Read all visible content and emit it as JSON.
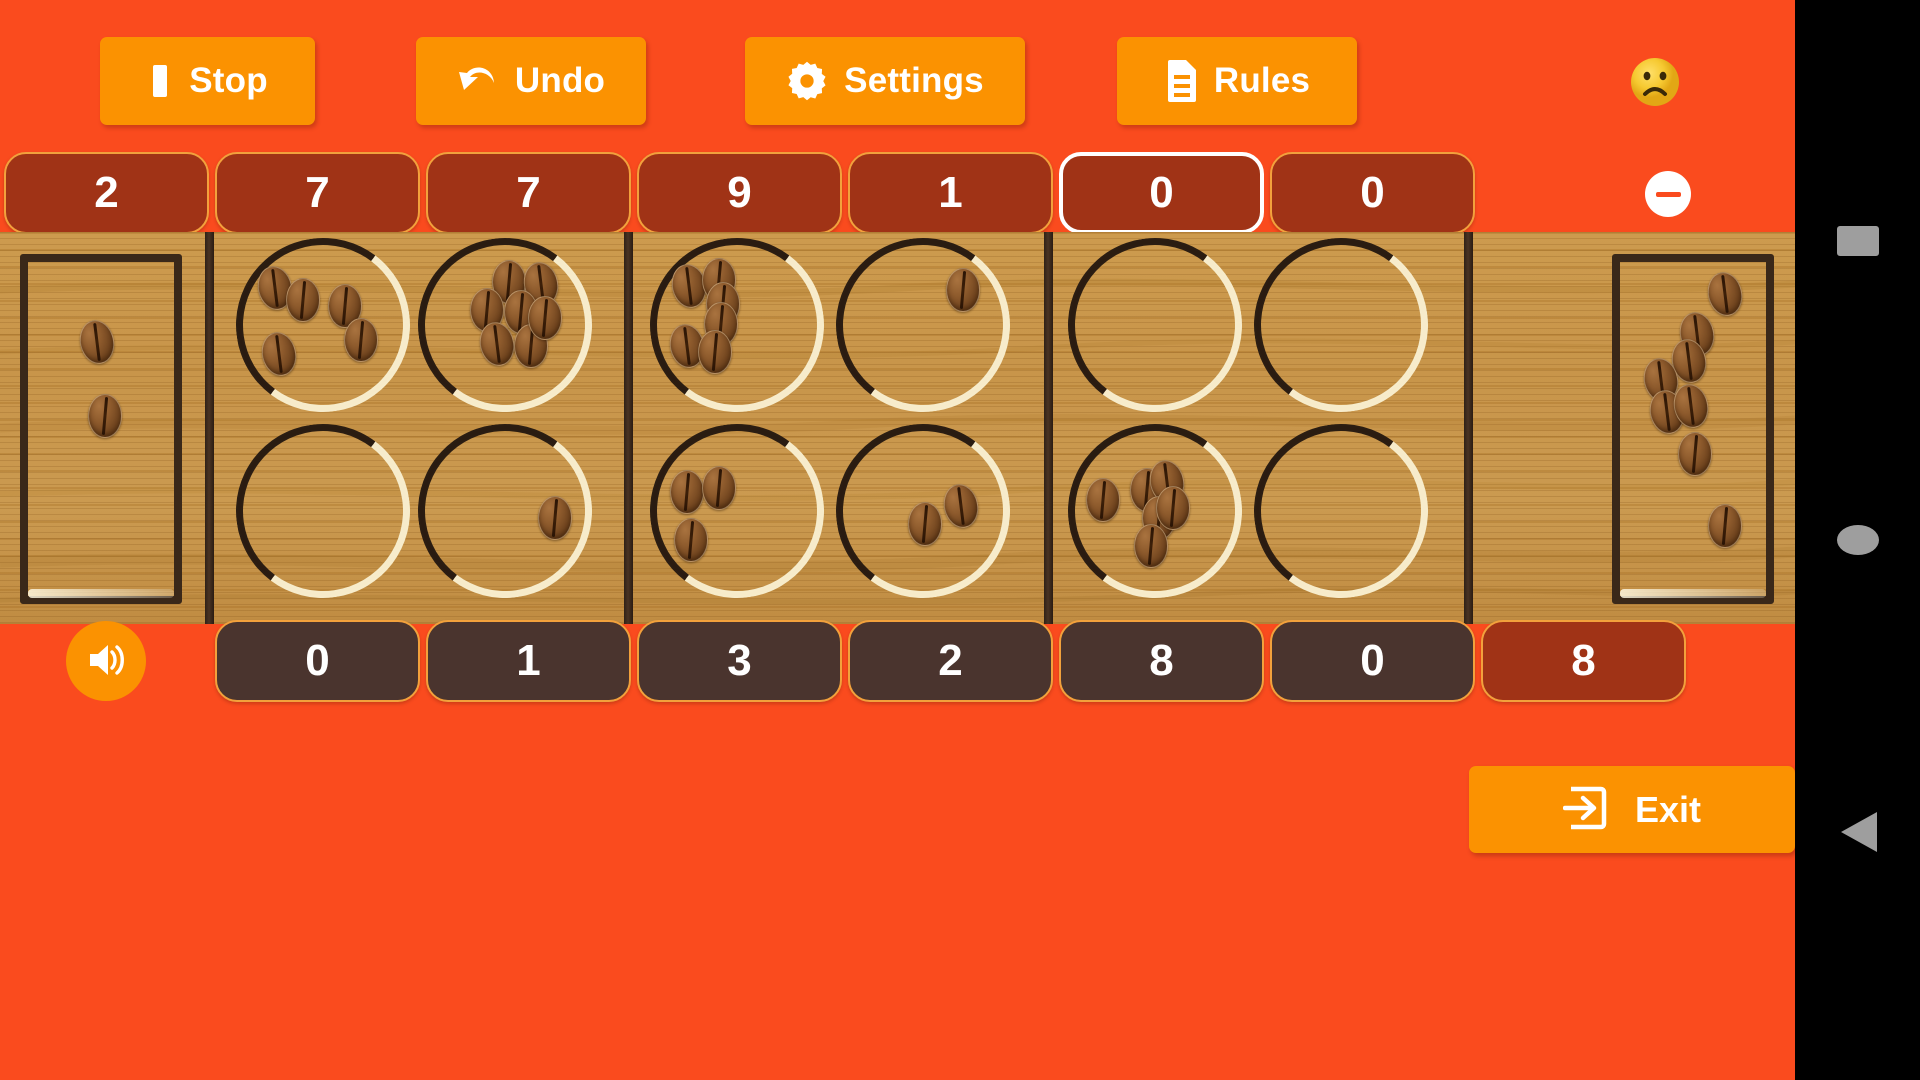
{
  "app": {
    "background_color": "#fa4b1e",
    "board_color": "#c8954a",
    "accent_color": "#fb9201",
    "top_cell_color": "#a03316",
    "bottom_cell_color": "#4a342e"
  },
  "toolbar": {
    "buttons": [
      {
        "id": "stop",
        "label": "Stop",
        "icon": "stop-square-icon"
      },
      {
        "id": "undo",
        "label": "Undo",
        "icon": "undo-arrow-icon"
      },
      {
        "id": "settings",
        "label": "Settings",
        "icon": "gear-icon"
      },
      {
        "id": "rules",
        "label": "Rules",
        "icon": "document-icon"
      }
    ],
    "status_face": {
      "icon": "frowning-face-emoji",
      "glyph": "☹",
      "color": "#f5c33b"
    }
  },
  "top_row": {
    "cells": [
      {
        "value": "2",
        "selected": false
      },
      {
        "value": "7",
        "selected": false
      },
      {
        "value": "7",
        "selected": false
      },
      {
        "value": "9",
        "selected": false
      },
      {
        "value": "1",
        "selected": false
      },
      {
        "value": "0",
        "selected": true
      },
      {
        "value": "0",
        "selected": false
      }
    ],
    "minus_button": {
      "icon": "minus-circle-icon",
      "label": "−"
    }
  },
  "bottom_row": {
    "sound_button": {
      "icon": "speaker-on-icon"
    },
    "cells": [
      {
        "value": "0",
        "selected": false
      },
      {
        "value": "1",
        "selected": false
      },
      {
        "value": "3",
        "selected": false
      },
      {
        "value": "2",
        "selected": false
      },
      {
        "value": "8",
        "selected": false
      },
      {
        "value": "0",
        "selected": false
      }
    ],
    "store_cell": {
      "value": "8",
      "selected": false
    }
  },
  "board": {
    "left_store": {
      "name": "left-store",
      "seeds": 2
    },
    "right_store": {
      "name": "right-store",
      "seeds": 8
    },
    "top_pits": {
      "seeds": [
        4,
        7,
        5,
        1,
        0,
        0
      ]
    },
    "bottom_pits": {
      "seeds": [
        0,
        1,
        3,
        2,
        6,
        0
      ]
    },
    "seed_icon": "coffee-bean"
  },
  "footer": {
    "exit_button": {
      "label": "Exit",
      "icon": "exit-arrow-icon"
    }
  },
  "navbar": {
    "keys": [
      {
        "id": "recents",
        "icon": "square-recents-icon"
      },
      {
        "id": "home",
        "icon": "circle-home-icon"
      },
      {
        "id": "back",
        "icon": "triangle-back-icon"
      }
    ]
  }
}
